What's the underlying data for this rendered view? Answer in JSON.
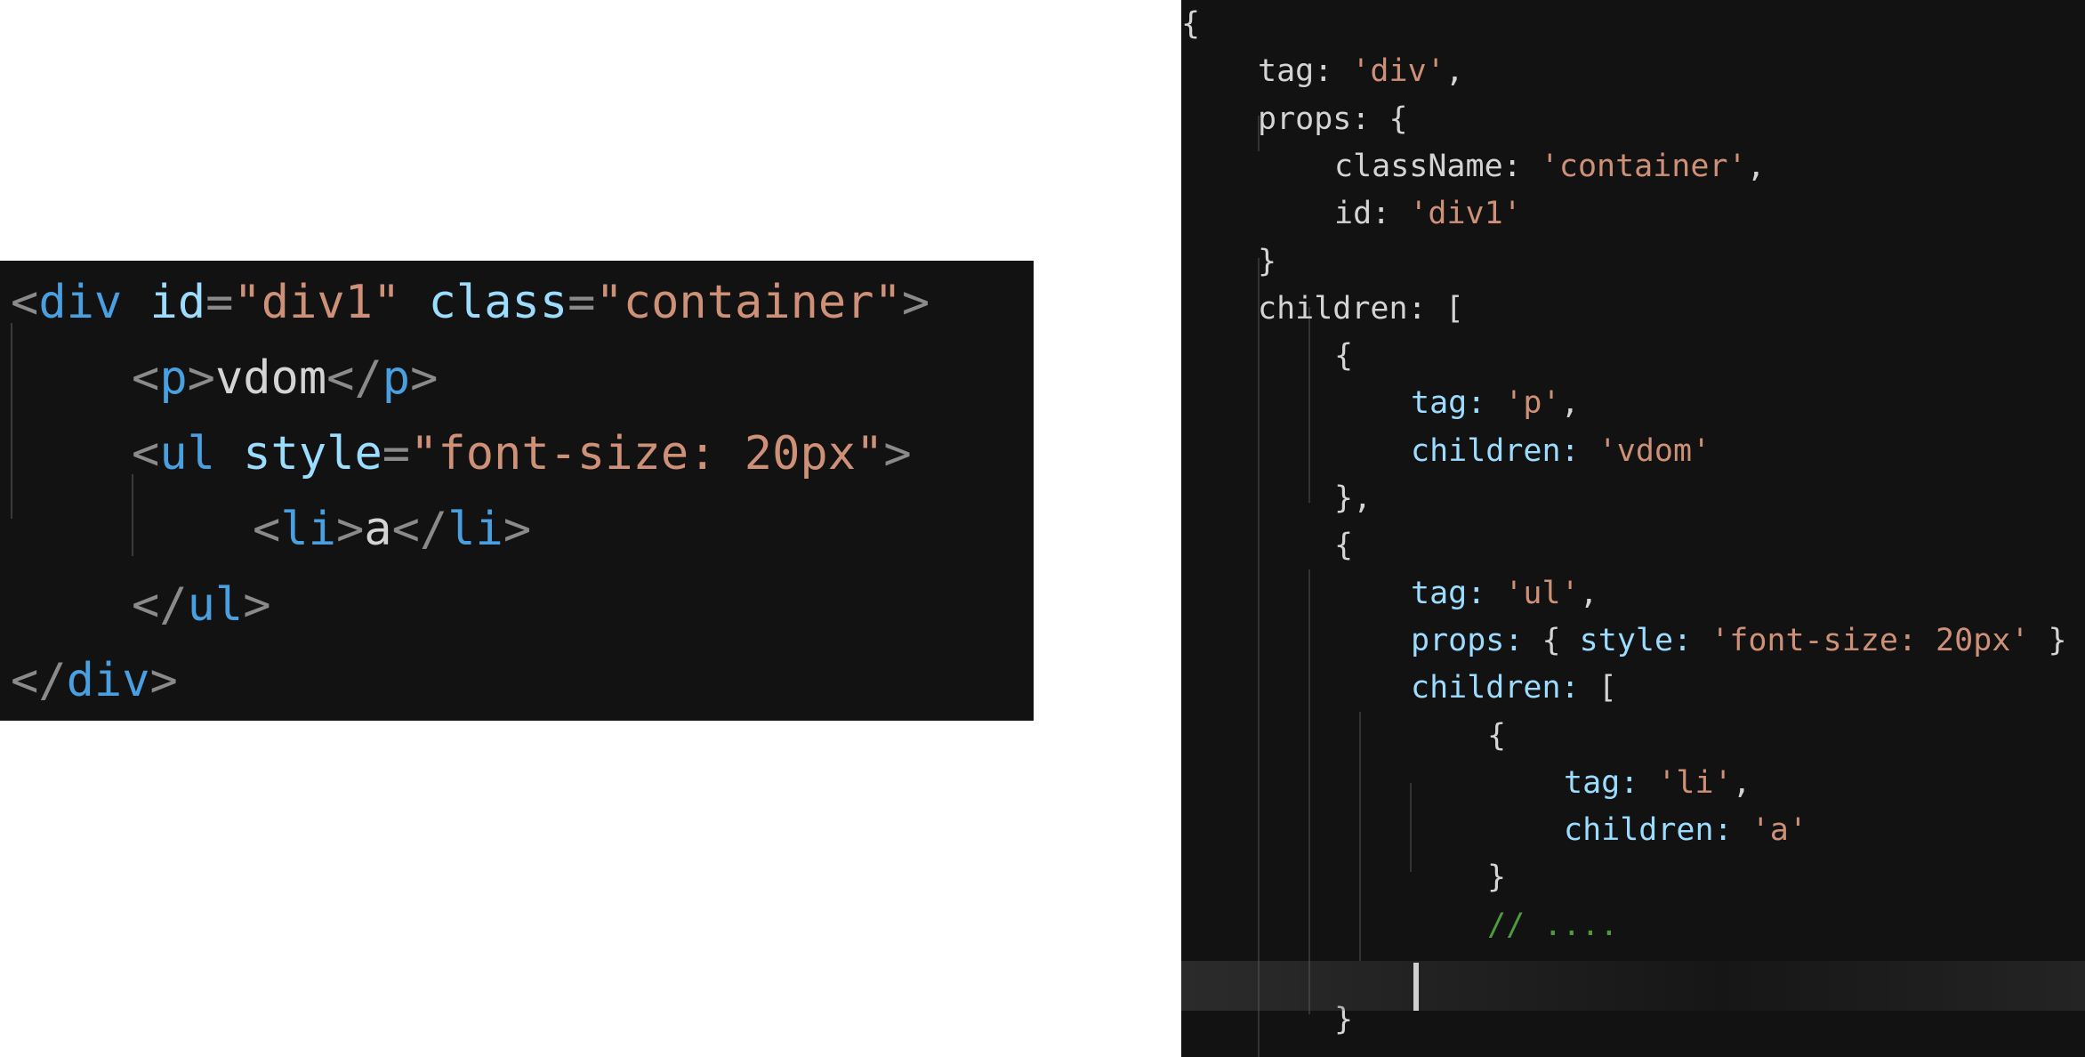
{
  "html_panel": {
    "lines": [
      {
        "indent": 0,
        "tokens": [
          {
            "c": "pun",
            "t": "<"
          },
          {
            "c": "tag",
            "t": "div"
          },
          {
            "c": "att",
            "t": " id"
          },
          {
            "c": "pun",
            "t": "="
          },
          {
            "c": "str",
            "t": "\"div1\""
          },
          {
            "c": "att",
            "t": " class"
          },
          {
            "c": "pun",
            "t": "="
          },
          {
            "c": "str",
            "t": "\"container\""
          },
          {
            "c": "pun",
            "t": ">"
          }
        ]
      },
      {
        "indent": 1,
        "tokens": [
          {
            "c": "pun",
            "t": "<"
          },
          {
            "c": "tag",
            "t": "p"
          },
          {
            "c": "pun",
            "t": ">"
          },
          {
            "c": "txt",
            "t": "vdom"
          },
          {
            "c": "pun",
            "t": "</"
          },
          {
            "c": "tag",
            "t": "p"
          },
          {
            "c": "pun",
            "t": ">"
          }
        ]
      },
      {
        "indent": 1,
        "tokens": [
          {
            "c": "pun",
            "t": "<"
          },
          {
            "c": "tag",
            "t": "ul"
          },
          {
            "c": "att",
            "t": " style"
          },
          {
            "c": "pun",
            "t": "="
          },
          {
            "c": "str",
            "t": "\"font-size: 20px\""
          },
          {
            "c": "pun",
            "t": ">"
          }
        ]
      },
      {
        "indent": 2,
        "tokens": [
          {
            "c": "pun",
            "t": "<"
          },
          {
            "c": "tag",
            "t": "li"
          },
          {
            "c": "pun",
            "t": ">"
          },
          {
            "c": "txt",
            "t": "a"
          },
          {
            "c": "pun",
            "t": "</"
          },
          {
            "c": "tag",
            "t": "li"
          },
          {
            "c": "pun",
            "t": ">"
          }
        ]
      },
      {
        "indent": 1,
        "tokens": [
          {
            "c": "pun",
            "t": "</"
          },
          {
            "c": "tag",
            "t": "ul"
          },
          {
            "c": "pun",
            "t": ">"
          }
        ]
      },
      {
        "indent": 0,
        "tokens": [
          {
            "c": "pun",
            "t": "</"
          },
          {
            "c": "tag",
            "t": "div"
          },
          {
            "c": "pun",
            "t": ">"
          }
        ]
      }
    ]
  },
  "vnode_panel": {
    "lines": [
      {
        "indent": 0,
        "tokens": [
          {
            "c": "plain",
            "t": "{"
          }
        ]
      },
      {
        "indent": 1,
        "tokens": [
          {
            "c": "plain",
            "t": "tag: "
          },
          {
            "c": "str",
            "t": "'div'"
          },
          {
            "c": "plain",
            "t": ","
          }
        ]
      },
      {
        "indent": 1,
        "tokens": [
          {
            "c": "plain",
            "t": "props: {"
          }
        ]
      },
      {
        "indent": 2,
        "tokens": [
          {
            "c": "plain",
            "t": "className: "
          },
          {
            "c": "str",
            "t": "'container'"
          },
          {
            "c": "plain",
            "t": ","
          }
        ]
      },
      {
        "indent": 2,
        "tokens": [
          {
            "c": "plain",
            "t": "id: "
          },
          {
            "c": "str",
            "t": "'div1'"
          }
        ]
      },
      {
        "indent": 1,
        "tokens": [
          {
            "c": "plain",
            "t": "}"
          }
        ]
      },
      {
        "indent": 1,
        "tokens": [
          {
            "c": "plain",
            "t": "children: ["
          }
        ]
      },
      {
        "indent": 2,
        "tokens": [
          {
            "c": "plain",
            "t": "{"
          }
        ]
      },
      {
        "indent": 3,
        "tokens": [
          {
            "c": "key",
            "t": "tag: "
          },
          {
            "c": "str",
            "t": "'p'"
          },
          {
            "c": "plain",
            "t": ","
          }
        ]
      },
      {
        "indent": 3,
        "tokens": [
          {
            "c": "key",
            "t": "children: "
          },
          {
            "c": "str",
            "t": "'vdom'"
          }
        ]
      },
      {
        "indent": 2,
        "tokens": [
          {
            "c": "plain",
            "t": "},"
          }
        ]
      },
      {
        "indent": 2,
        "tokens": [
          {
            "c": "plain",
            "t": "{"
          }
        ]
      },
      {
        "indent": 3,
        "tokens": [
          {
            "c": "key",
            "t": "tag: "
          },
          {
            "c": "str",
            "t": "'ul'"
          },
          {
            "c": "plain",
            "t": ","
          }
        ]
      },
      {
        "indent": 3,
        "tokens": [
          {
            "c": "key",
            "t": "props: "
          },
          {
            "c": "plain",
            "t": "{ "
          },
          {
            "c": "key",
            "t": "style: "
          },
          {
            "c": "str",
            "t": "'font-size: 20px'"
          },
          {
            "c": "plain",
            "t": " }"
          }
        ]
      },
      {
        "indent": 3,
        "tokens": [
          {
            "c": "key",
            "t": "children: "
          },
          {
            "c": "plain",
            "t": "["
          }
        ]
      },
      {
        "indent": 4,
        "tokens": [
          {
            "c": "plain",
            "t": "{"
          }
        ]
      },
      {
        "indent": 5,
        "tokens": [
          {
            "c": "key",
            "t": "tag: "
          },
          {
            "c": "str",
            "t": "'li'"
          },
          {
            "c": "plain",
            "t": ","
          }
        ]
      },
      {
        "indent": 5,
        "tokens": [
          {
            "c": "key",
            "t": "children: "
          },
          {
            "c": "str",
            "t": "'a'"
          }
        ]
      },
      {
        "indent": 4,
        "tokens": [
          {
            "c": "plain",
            "t": "}"
          }
        ]
      },
      {
        "indent": 4,
        "tokens": [
          {
            "c": "cmt",
            "t": "// ...."
          }
        ]
      },
      {
        "indent": 3,
        "tokens": [
          {
            "c": "plain",
            "t": ""
          }
        ]
      },
      {
        "indent": 2,
        "tokens": [
          {
            "c": "plain",
            "t": "}"
          }
        ]
      }
    ]
  },
  "colors": {
    "editor_background": "#121212",
    "tag": "#4a9fe0",
    "attribute": "#9cdcfe",
    "string": "#ce9178",
    "punctuation": "#8a8a8a",
    "comment": "#4e9a3c",
    "text": "#d4d4d4"
  }
}
